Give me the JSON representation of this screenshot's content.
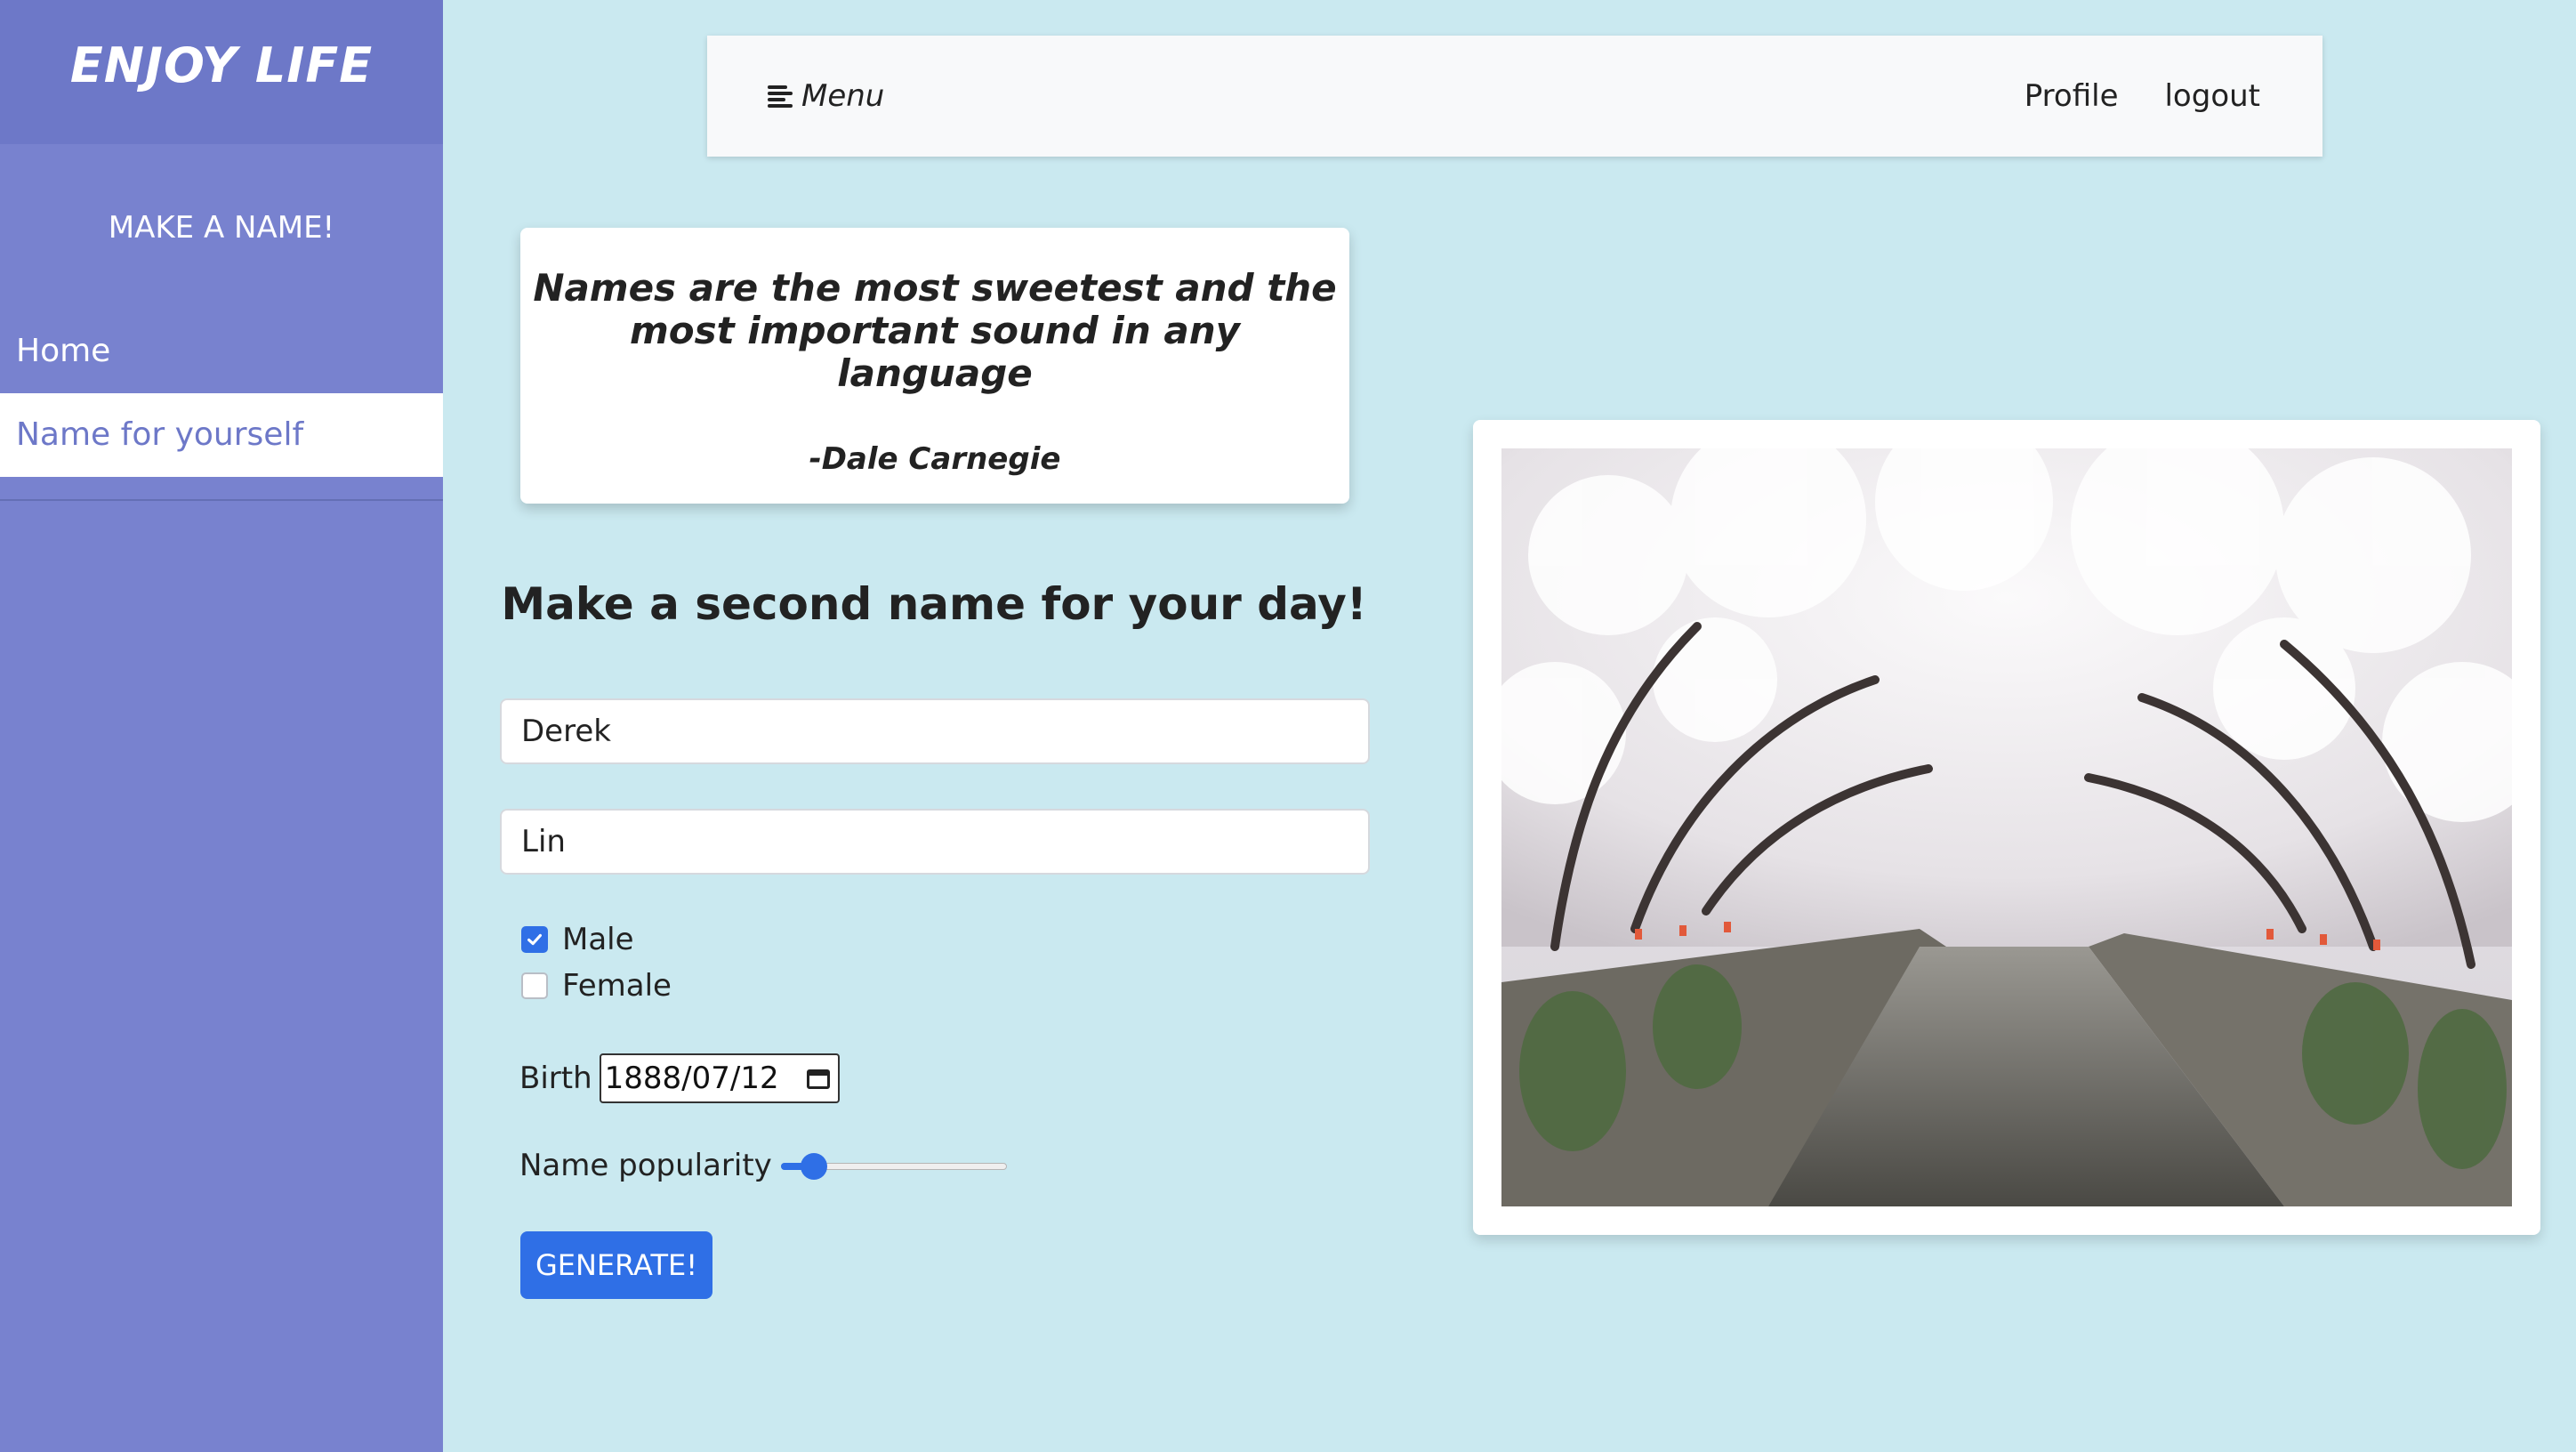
{
  "sidebar": {
    "brand": "ENJOY LIFE",
    "subtitle": "MAKE A NAME!",
    "items": [
      {
        "label": "Home",
        "active": false
      },
      {
        "label": "Name for yourself",
        "active": true
      }
    ]
  },
  "topbar": {
    "menu_label": "Menu",
    "links": [
      "Profile",
      "logout"
    ]
  },
  "quote": {
    "text": "Names are the most sweetest and the most important sound in any language",
    "author": "-Dale Carnegie"
  },
  "form": {
    "title": "Make a second name for your day!",
    "first_name": "Derek",
    "last_name": "Lin",
    "gender_options": [
      {
        "label": "Male",
        "checked": true
      },
      {
        "label": "Female",
        "checked": false
      }
    ],
    "birth_label": "Birth",
    "birth_value": "1888/07/12",
    "popularity_label": "Name popularity",
    "popularity_value": 0.1,
    "submit_label": "GENERATE!"
  },
  "colors": {
    "page_bg": "#cae9f0",
    "sidebar_bg": "#7882cf",
    "accent_blue": "#2f6fe6"
  },
  "icons": {
    "menu": "menu-lines-icon",
    "calendar": "calendar-icon",
    "check": "checkmark-icon"
  }
}
